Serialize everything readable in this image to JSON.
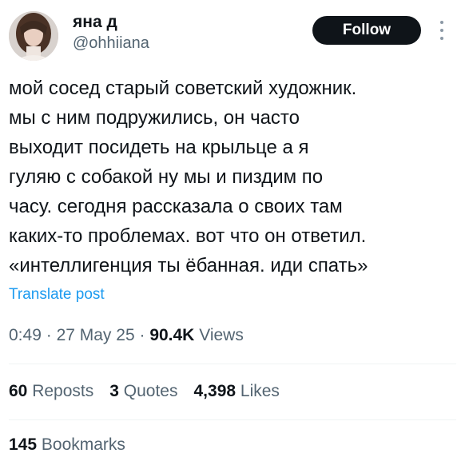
{
  "user": {
    "display_name": "яна д",
    "handle": "@ohhiiana",
    "follow_label": "Follow"
  },
  "tweet": {
    "lines": [
      "мой сосед старый советский художник.",
      "мы с ним подружились, он часто",
      "выходит посидеть на крыльце а я",
      "гуляю с собакой ну мы и пиздим по",
      "часу. сегодня рассказала о своих там",
      "каких-то проблемах. вот что он ответил.",
      "«интеллигенция ты ёбанная. иди спать»"
    ],
    "translate_label": "Translate post"
  },
  "meta": {
    "time": "0:49",
    "date": "27 May 25",
    "separator": "·",
    "views_count": "90.4K",
    "views_label": "Views"
  },
  "stats": {
    "reposts": {
      "count": "60",
      "label": "Reposts"
    },
    "quotes": {
      "count": "3",
      "label": "Quotes"
    },
    "likes": {
      "count": "4,398",
      "label": "Likes"
    },
    "bookmarks": {
      "count": "145",
      "label": "Bookmarks"
    }
  },
  "icons": {
    "more": "more-vertical-icon"
  },
  "colors": {
    "text": "#0f1419",
    "secondary": "#536471",
    "link": "#1d9bf0",
    "follow_bg": "#0f1419",
    "follow_text": "#ffffff",
    "divider": "#eff3f4"
  }
}
